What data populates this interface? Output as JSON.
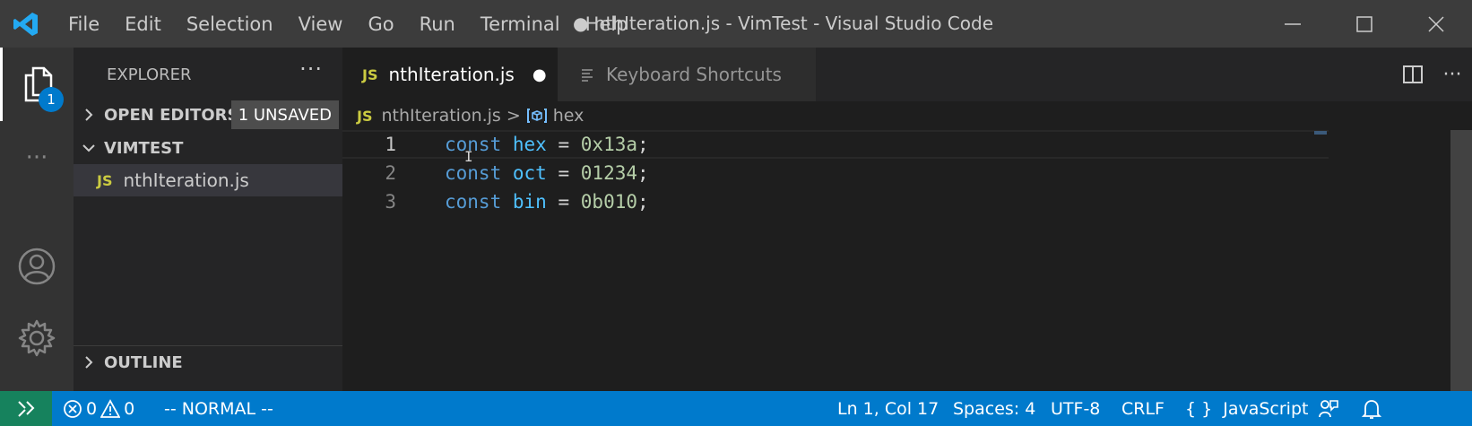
{
  "title_bar": {
    "menu": [
      "File",
      "Edit",
      "Selection",
      "View",
      "Go",
      "Run",
      "Terminal",
      "Help"
    ],
    "window_title": "● nthIteration.js - VimTest - Visual Studio Code"
  },
  "activity_bar": {
    "explorer_badge": "1",
    "more": "···"
  },
  "sidebar": {
    "title": "EXPLORER",
    "more": "···",
    "open_editors": {
      "label": "OPEN EDITORS",
      "badge": "1 UNSAVED"
    },
    "folder": {
      "label": "VIMTEST"
    },
    "files": [
      {
        "tag": "JS",
        "name": "nthIteration.js"
      }
    ],
    "outline": {
      "label": "OUTLINE"
    }
  },
  "tabs": [
    {
      "tag": "JS",
      "name": "nthIteration.js",
      "dirty": "●"
    },
    {
      "name": "Keyboard Shortcuts"
    }
  ],
  "breadcrumb": {
    "tag": "JS",
    "file": "nthIteration.js",
    "separator": ">",
    "symbol": "hex"
  },
  "code": {
    "lines": [
      {
        "num": "1",
        "kw": "const",
        "name": "hex",
        "op": "=",
        "value": "0x13a",
        "end": ";"
      },
      {
        "num": "2",
        "kw": "const",
        "name": "oct",
        "op": "=",
        "value": "01234",
        "end": ";"
      },
      {
        "num": "3",
        "kw": "const",
        "name": "bin",
        "op": "=",
        "value": "0b010",
        "end": ";"
      }
    ]
  },
  "status_bar": {
    "errors": "0",
    "warnings": "0",
    "vim_mode": "-- NORMAL --",
    "position": "Ln 1, Col 17",
    "indent": "Spaces: 4",
    "encoding": "UTF-8",
    "eol": "CRLF",
    "language_icon": "{ }",
    "language": "JavaScript"
  },
  "colors": {
    "accent": "#007acc",
    "remote": "#16825d",
    "keyword": "#569cd6",
    "variable": "#4fc1ff",
    "number": "#b5cea8",
    "js_tag": "#cbcb41"
  }
}
